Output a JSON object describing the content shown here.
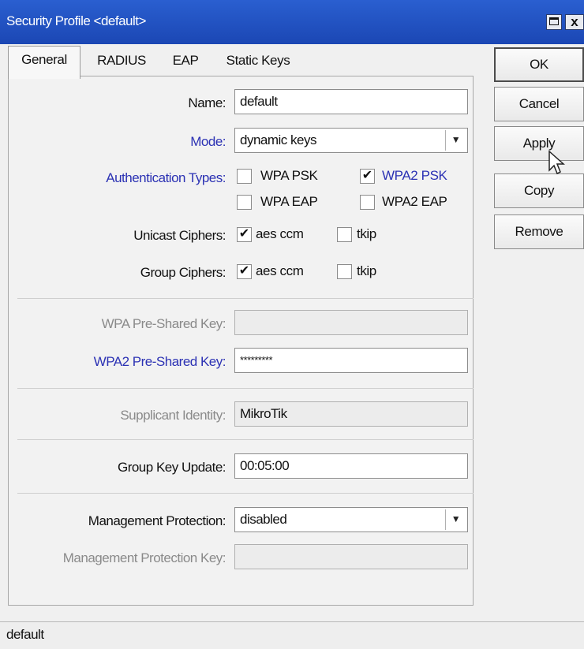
{
  "window": {
    "title": "Security Profile <default>",
    "maximize_glyph": "",
    "close_glyph": "x"
  },
  "tabs": [
    {
      "label": "General",
      "active": true
    },
    {
      "label": "RADIUS",
      "active": false
    },
    {
      "label": "EAP",
      "active": false
    },
    {
      "label": "Static Keys",
      "active": false
    }
  ],
  "form": {
    "name": {
      "label": "Name:",
      "value": "default"
    },
    "mode": {
      "label": "Mode:",
      "value": "dynamic keys",
      "arrow_icon": "dropdown-arrow-icon"
    },
    "auth_types": {
      "label": "Authentication Types:",
      "options": [
        {
          "label": "WPA PSK",
          "checked": false
        },
        {
          "label": "WPA2 PSK",
          "checked": true
        },
        {
          "label": "WPA EAP",
          "checked": false
        },
        {
          "label": "WPA2 EAP",
          "checked": false
        }
      ]
    },
    "unicast_ciphers": {
      "label": "Unicast Ciphers:",
      "options": [
        {
          "label": "aes ccm",
          "checked": true
        },
        {
          "label": "tkip",
          "checked": false
        }
      ]
    },
    "group_ciphers": {
      "label": "Group Ciphers:",
      "options": [
        {
          "label": "aes ccm",
          "checked": true
        },
        {
          "label": "tkip",
          "checked": false
        }
      ]
    },
    "wpa_psk": {
      "label": "WPA Pre-Shared Key:",
      "value": ""
    },
    "wpa2_psk": {
      "label": "WPA2 Pre-Shared Key:",
      "value": "*********"
    },
    "supplicant_identity": {
      "label": "Supplicant Identity:",
      "value": "MikroTik"
    },
    "group_key_update": {
      "label": "Group Key Update:",
      "value": "00:05:00"
    },
    "mgmt_protection": {
      "label": "Management Protection:",
      "value": "disabled",
      "arrow_icon": "dropdown-arrow-icon"
    },
    "mgmt_protection_key": {
      "label": "Management Protection Key:",
      "value": ""
    }
  },
  "buttons": {
    "ok": "OK",
    "cancel": "Cancel",
    "apply": "Apply",
    "copy": "Copy",
    "remove": "Remove"
  },
  "check_glyph": "✔",
  "dropdown_glyph": "▼",
  "status": {
    "text": "default"
  },
  "colors": {
    "titlebar": "#1b47b4",
    "label_blue": "#2c32b4",
    "label_gray": "#8a8a8a"
  }
}
